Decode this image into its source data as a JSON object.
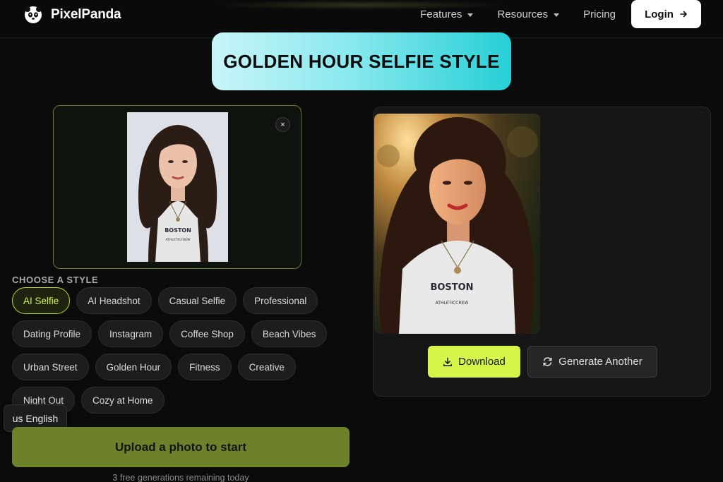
{
  "nav": {
    "brand": "PixelPanda",
    "links": [
      {
        "label": "Features",
        "dropdown": true
      },
      {
        "label": "Resources",
        "dropdown": true
      },
      {
        "label": "Pricing",
        "dropdown": false
      }
    ],
    "login_label": "Login"
  },
  "banner": {
    "title": "GOLDEN HOUR SELFIE STYLE"
  },
  "preview": {
    "close_symbol": "×"
  },
  "styles": {
    "heading": "CHOOSE A STYLE",
    "selected": "AI Selfie",
    "rows": [
      [
        "AI Selfie",
        "AI Headshot",
        "Casual Selfie",
        "Professional"
      ],
      [
        "Dating Profile",
        "Instagram",
        "Coffee Shop",
        "Beach Vibes"
      ],
      [
        "Urban Street",
        "Golden Hour",
        "Fitness",
        "Creative"
      ],
      [
        "Night Out",
        "Cozy at Home"
      ]
    ]
  },
  "language": {
    "label": "us English"
  },
  "upload": {
    "label": "Upload a photo to start",
    "note": "3 free generations remaining today"
  },
  "result": {
    "download_label": "Download",
    "regenerate_label": "Generate Another"
  },
  "colors": {
    "accent": "#d5f54b",
    "upload_button": "#6c812a",
    "banner_end": "#27cfd6"
  }
}
